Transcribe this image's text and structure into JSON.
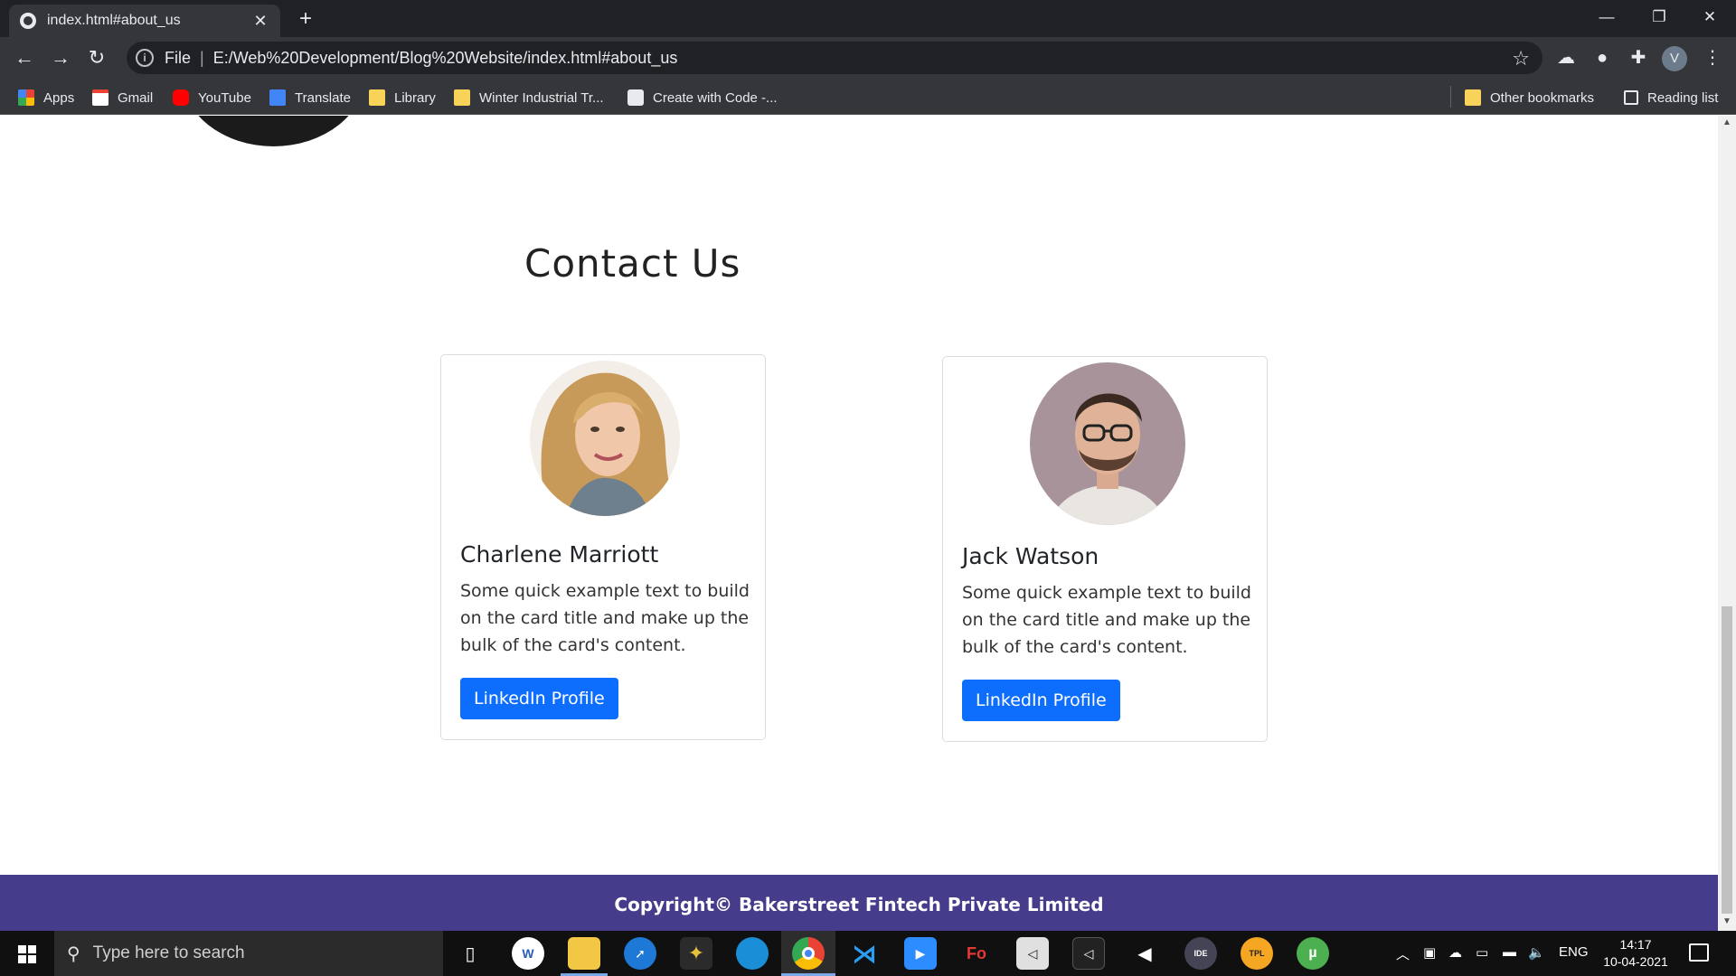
{
  "browser": {
    "tab_title": "index.html#about_us",
    "tab_close": "✕",
    "new_tab": "+",
    "window": {
      "minimize": "—",
      "restore": "❐",
      "close": "✕"
    },
    "nav": {
      "back": "←",
      "forward": "→",
      "reload": "↻"
    },
    "address": {
      "scheme_label": "File",
      "separator": "|",
      "url": "E:/Web%20Development/Blog%20Website/index.html#about_us",
      "info_icon": "i",
      "star_icon": "☆"
    },
    "profile_initial": "V",
    "bookmarks": [
      {
        "label": "Apps",
        "icon": "apps-grid-icon"
      },
      {
        "label": "Gmail",
        "icon": "gmail-icon"
      },
      {
        "label": "YouTube",
        "icon": "youtube-icon"
      },
      {
        "label": "Translate",
        "icon": "translate-icon"
      },
      {
        "label": "Library",
        "icon": "folder-icon"
      },
      {
        "label": "Winter Industrial Tr...",
        "icon": "folder-icon"
      },
      {
        "label": "Create with Code -...",
        "icon": "unity-icon"
      },
      {
        "label": "Other bookmarks",
        "icon": "folder-icon"
      },
      {
        "label": "Reading list",
        "icon": "reading-list-icon"
      }
    ]
  },
  "page": {
    "section_title": "Contact Us",
    "cards": [
      {
        "name": "Charlene Marriott",
        "description": "Some quick example text to build on the card title and make up the bulk of the card's content.",
        "button_label": "LinkedIn Profile"
      },
      {
        "name": "Jack Watson",
        "description": "Some quick example text to build on the card title and make up the bulk of the card's content.",
        "button_label": "LinkedIn Profile"
      }
    ],
    "footer_text": "Copyright© Bakerstreet Fintech Private Limited"
  },
  "taskbar": {
    "search_placeholder": "Type here to search",
    "tray_language": "ENG",
    "time": "14:17",
    "date": "10-04-2021"
  },
  "colors": {
    "primary_button": "#0d6efd",
    "footer_bg": "#463c8c",
    "browser_dark": "#202124",
    "browser_toolbar": "#35363a"
  }
}
